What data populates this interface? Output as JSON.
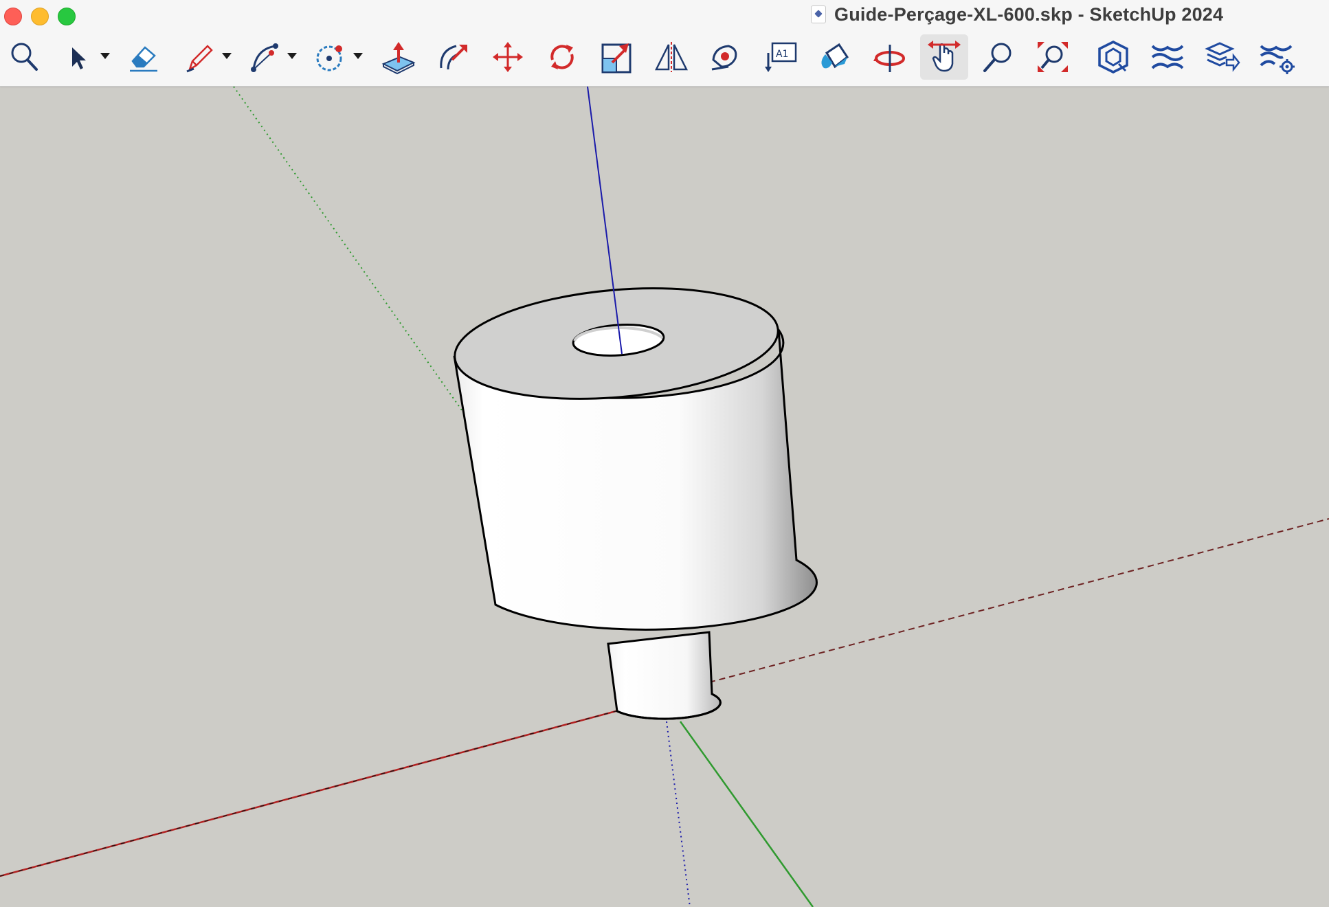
{
  "window": {
    "title": "Guide-Perçage-XL-600.skp - SketchUp 2024",
    "controls": [
      "close",
      "minimize",
      "zoom"
    ]
  },
  "toolbar": {
    "tools": [
      {
        "name": "search-icon",
        "has_menu": false,
        "active": false
      },
      {
        "name": "select-arrow-icon",
        "has_menu": true,
        "active": false
      },
      {
        "name": "eraser-icon",
        "has_menu": false,
        "active": false
      },
      {
        "name": "pencil-line-icon",
        "has_menu": true,
        "active": false
      },
      {
        "name": "arc-icon",
        "has_menu": true,
        "active": false
      },
      {
        "name": "circle-shapes-icon",
        "has_menu": true,
        "active": false
      },
      {
        "name": "push-pull-icon",
        "has_menu": false,
        "active": false
      },
      {
        "name": "offset-icon",
        "has_menu": false,
        "active": false
      },
      {
        "name": "move-icon",
        "has_menu": false,
        "active": false
      },
      {
        "name": "rotate-icon",
        "has_menu": false,
        "active": false
      },
      {
        "name": "scale-icon",
        "has_menu": false,
        "active": false
      },
      {
        "name": "flip-mirror-icon",
        "has_menu": false,
        "active": false
      },
      {
        "name": "tape-measure-icon",
        "has_menu": false,
        "active": false
      },
      {
        "name": "text-label-icon",
        "has_menu": false,
        "active": false
      },
      {
        "name": "paint-bucket-icon",
        "has_menu": false,
        "active": false
      },
      {
        "name": "orbit-icon",
        "has_menu": false,
        "active": false
      },
      {
        "name": "pan-hand-icon",
        "has_menu": false,
        "active": true
      },
      {
        "name": "zoom-icon",
        "has_menu": false,
        "active": false
      },
      {
        "name": "zoom-extents-icon",
        "has_menu": false,
        "active": false
      },
      {
        "name": "3d-warehouse-icon",
        "has_menu": false,
        "active": false
      },
      {
        "name": "extension-warehouse-icon",
        "has_menu": false,
        "active": false
      },
      {
        "name": "layout-send-icon",
        "has_menu": false,
        "active": false
      },
      {
        "name": "extension-manager-icon",
        "has_menu": false,
        "active": false
      }
    ]
  },
  "viewport": {
    "background_color": "#cdccc7",
    "axis_colors": {
      "red": "#b22222",
      "green": "#2f9a2f",
      "blue": "#1a1aaa"
    },
    "model": "stepped-cylinder-with-bore"
  }
}
